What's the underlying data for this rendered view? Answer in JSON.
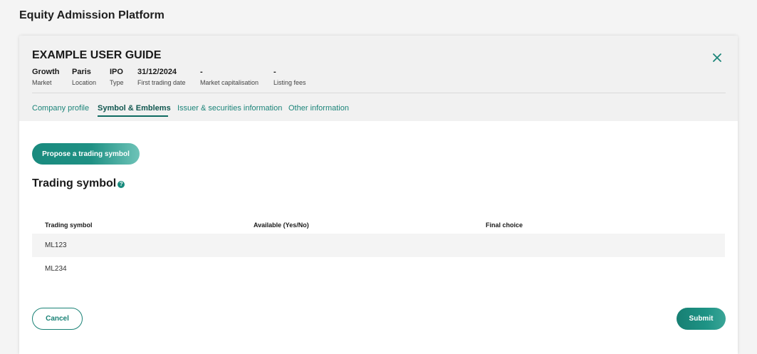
{
  "app": {
    "title": "Equity Admission Platform"
  },
  "header": {
    "title": "EXAMPLE USER GUIDE",
    "close_icon": "close-icon",
    "meta": [
      {
        "value": "Growth",
        "label": "Market"
      },
      {
        "value": "Paris",
        "label": "Location"
      },
      {
        "value": "IPO",
        "label": "Type"
      },
      {
        "value": "31/12/2024",
        "label": "First trading date"
      },
      {
        "value": "-",
        "label": "Market capitalisation"
      },
      {
        "value": "-",
        "label": "Listing fees"
      }
    ]
  },
  "tabs": [
    {
      "label": "Company profile",
      "active": false
    },
    {
      "label": "Symbol & Emblems",
      "active": true
    },
    {
      "label": "Issuer & securities information",
      "active": false
    },
    {
      "label": "Other information",
      "active": false
    }
  ],
  "main": {
    "propose_button": "Propose a trading symbol",
    "section_title": "Trading symbol",
    "help_icon_glyph": "?",
    "table": {
      "columns": [
        "Trading symbol",
        "Available (Yes/No)",
        "Final choice"
      ],
      "rows": [
        {
          "symbol": "ML123",
          "available": "",
          "final_choice": ""
        },
        {
          "symbol": "ML234",
          "available": "",
          "final_choice": ""
        }
      ]
    }
  },
  "footer": {
    "cancel_label": "Cancel",
    "submit_label": "Submit"
  },
  "colors": {
    "accent": "#1b8479",
    "accent_dark": "#10564f",
    "header_bg": "#f1f1f1",
    "page_bg": "#f4f4f4"
  }
}
